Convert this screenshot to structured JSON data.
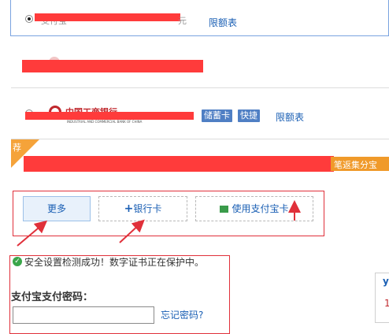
{
  "bank_list": {
    "row1_limit_link": "限额表",
    "row1_partial_text": "支付宝",
    "row1_partial_end": "元",
    "row3_bank_name": "中国工商银行",
    "row3_bank_sub": "INDUSTRIAL AND COMMERCIAL BANK OF CHINA",
    "row3_tag_debit": "储蓄卡",
    "row3_tag_express": "快捷",
    "row3_limit_link": "限额表",
    "row4_badge": "荐",
    "row4_promo": "笔返集分宝"
  },
  "payment_buttons": {
    "more": "更多",
    "bank_card_icon": "+",
    "bank_card": "银行卡",
    "use_alipay_card": "使用支付宝卡"
  },
  "security": {
    "status_text": "安全设置检测成功！数字证书正在保护中。",
    "password_label": "支付宝支付密码：",
    "forgot_password": "忘记密码?"
  },
  "side": {
    "top_char": "y",
    "bottom_char": "1"
  },
  "colors": {
    "redaction": "#ff3b3b",
    "link": "#1a5fb4",
    "tag_bg": "#4f7fc4",
    "badge": "#f5a33a",
    "promo_bg": "#f09a2a",
    "annotation": "#e0303a"
  }
}
